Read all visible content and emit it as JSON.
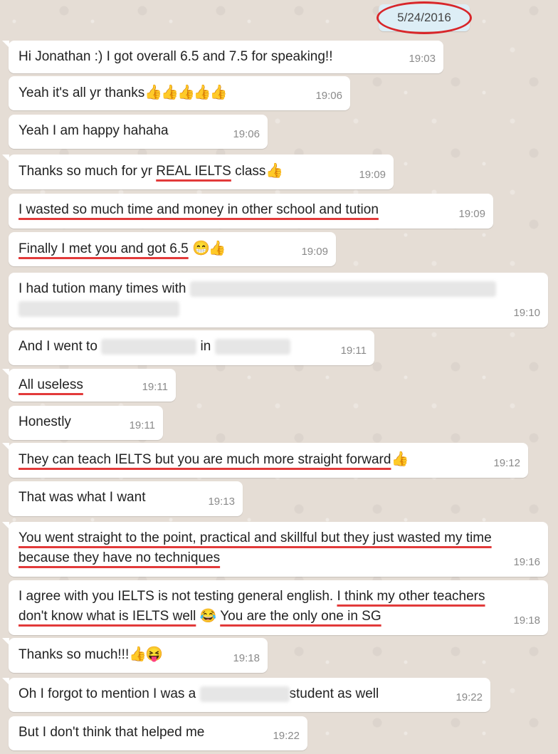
{
  "date_chip": "5/24/2016",
  "messages": [
    {
      "id": "m1",
      "text": "Hi Jonathan :) I got overall 6.5 and 7.5 for speaking!!",
      "time": "19:03"
    },
    {
      "id": "m2",
      "text": "Yeah it's all yr thanks",
      "emoji": "👍👍👍👍👍",
      "time": "19:06"
    },
    {
      "id": "m3",
      "text": "Yeah I am happy hahaha",
      "time": "19:06"
    },
    {
      "id": "m4",
      "text_pre": "Thanks so much for yr ",
      "text_hl": "REAL IELTS",
      "text_post": " class",
      "emoji": "👍",
      "time": "19:09"
    },
    {
      "id": "m5",
      "text": "I wasted so much time and money in other school and tution",
      "time": "19:09"
    },
    {
      "id": "m6",
      "text": "Finally I met you and got 6.5",
      "emoji": "😁👍",
      "time": "19:09"
    },
    {
      "id": "m7",
      "text": "I had tution many times with",
      "time": "19:10"
    },
    {
      "id": "m8",
      "text_pre": "And I went to",
      "text_mid": "in",
      "time": "19:11"
    },
    {
      "id": "m9",
      "text": "All useless",
      "time": "19:11"
    },
    {
      "id": "m10",
      "text": "Honestly",
      "time": "19:11"
    },
    {
      "id": "m11",
      "text": "They can teach IELTS but you are much more straight forward",
      "emoji": "👍",
      "time": "19:12"
    },
    {
      "id": "m12",
      "text": "That was what I want",
      "time": "19:13"
    },
    {
      "id": "m13",
      "line1": "You went straight to the point, practical and skillful but they just wasted my time",
      "line2": "because they have no techniques",
      "time": "19:16"
    },
    {
      "id": "m14",
      "line1_pre": "I agree with you IELTS is not testing general english. ",
      "line1_hl": "I think my other teachers",
      "line2_hl": "don't know what is IELTS well",
      "emoji": "😂",
      "line2_post": "You are the only one in SG",
      "time": "19:18"
    },
    {
      "id": "m15",
      "text": "Thanks so much!!!",
      "emoji": "👍😝",
      "time": "19:18"
    },
    {
      "id": "m16",
      "text_pre": "Oh I forgot to mention I was a",
      "text_post": "student as well",
      "time": "19:22"
    },
    {
      "id": "m17",
      "text": "But I don't think that helped me",
      "time": "19:22"
    }
  ]
}
